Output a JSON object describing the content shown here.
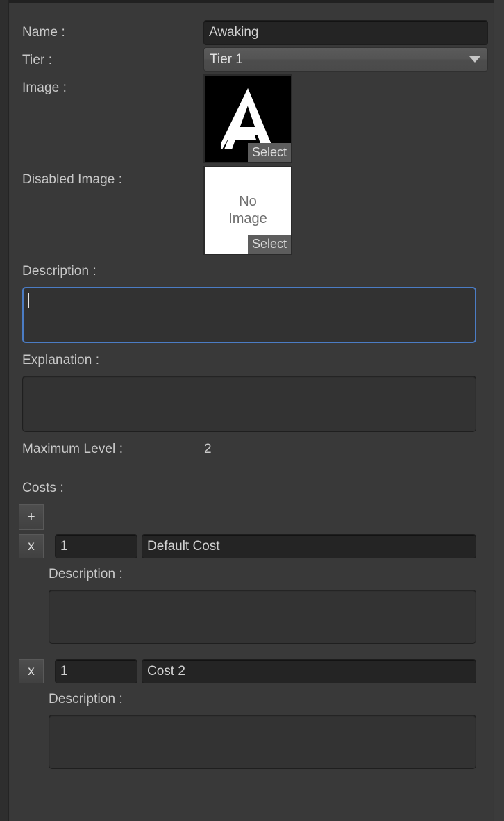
{
  "panel": {
    "background_color": "#393939",
    "label_color": "#c9c9c9",
    "focus_border_color": "#4b7cc4"
  },
  "fields": {
    "name": {
      "label": "Name :",
      "value": "Awaking",
      "placeholder": ""
    },
    "tier": {
      "label": "Tier :",
      "selected": "Tier 1",
      "options": [
        "Tier 1"
      ],
      "caret_icon": "chevron-down-icon"
    },
    "image": {
      "label": "Image :",
      "preview_kind": "sprite",
      "preview_glyph": "A",
      "select_label": "Select"
    },
    "disabled_image": {
      "label": "Disabled Image :",
      "preview_kind": "no-image",
      "no_image_line1": "No",
      "no_image_line2": "Image",
      "select_label": "Select"
    },
    "description": {
      "label": "Description :",
      "value": "",
      "focused": true
    },
    "explanation": {
      "label": "Explanation :",
      "value": "",
      "focused": false
    },
    "maximum_level": {
      "label": "Maximum Level :",
      "value": "2"
    }
  },
  "costs": {
    "label": "Costs :",
    "add_button_label": "+",
    "items": [
      {
        "remove_button_label": "x",
        "amount": "1",
        "name": "Default Cost",
        "description_label": "Description :",
        "description_value": ""
      },
      {
        "remove_button_label": "x",
        "amount": "1",
        "name": "Cost 2",
        "description_label": "Description :",
        "description_value": ""
      }
    ]
  }
}
